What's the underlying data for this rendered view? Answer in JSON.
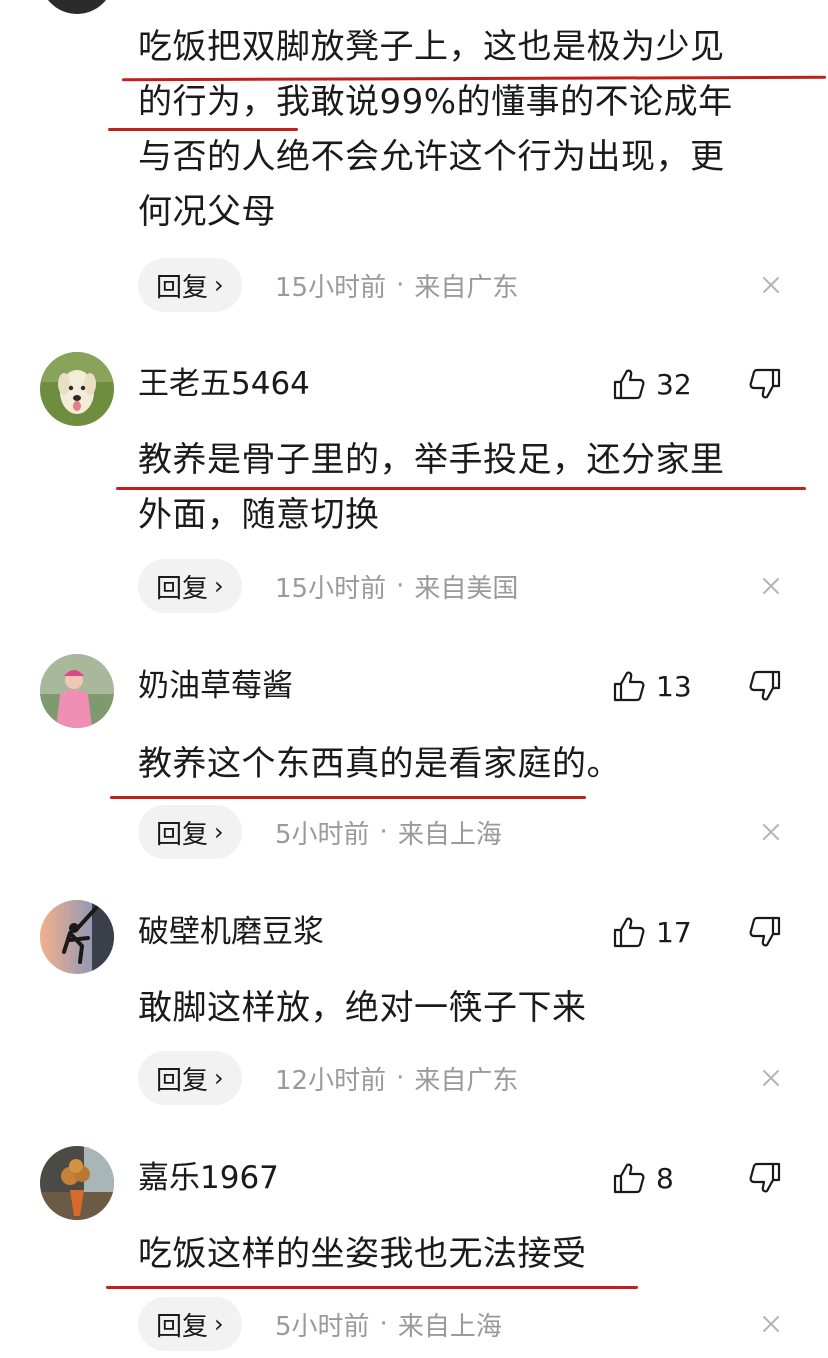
{
  "comments": [
    {
      "text_lines": [
        "吃饭把双脚放凳子上，这也是极为少见",
        "的行为，我敢说99%的懂事的不论成年",
        "与否的人绝不会允许这个行为出现，更",
        "何况父母"
      ],
      "reply_label": "回复",
      "time": "15小时前",
      "location": "来自广东"
    },
    {
      "username": "王老五5464",
      "likes": "32",
      "text_lines": [
        "教养是骨子里的，举手投足，还分家里",
        "外面，随意切换"
      ],
      "reply_label": "回复",
      "time": "15小时前",
      "location": "来自美国"
    },
    {
      "username": "奶油草莓酱",
      "likes": "13",
      "text_lines": [
        "教养这个东西真的是看家庭的。"
      ],
      "reply_label": "回复",
      "time": "5小时前",
      "location": "来自上海"
    },
    {
      "username": "破壁机磨豆浆",
      "likes": "17",
      "text_lines": [
        "敢脚这样放，绝对一筷子下来"
      ],
      "reply_label": "回复",
      "time": "12小时前",
      "location": "来自广东"
    },
    {
      "username": "嘉乐1967",
      "likes": "8",
      "text_lines": [
        "吃饭这样的坐姿我也无法接受"
      ],
      "reply_label": "回复",
      "time": "5小时前",
      "location": "来自上海"
    }
  ],
  "separator": "·",
  "colors": {
    "underline": "#c0201c",
    "meta": "#9a9a9a",
    "reply_bg": "#f2f2f2"
  },
  "icons": [
    "thumbs-up-icon",
    "thumbs-down-icon",
    "close-icon",
    "chevron-right-icon"
  ]
}
